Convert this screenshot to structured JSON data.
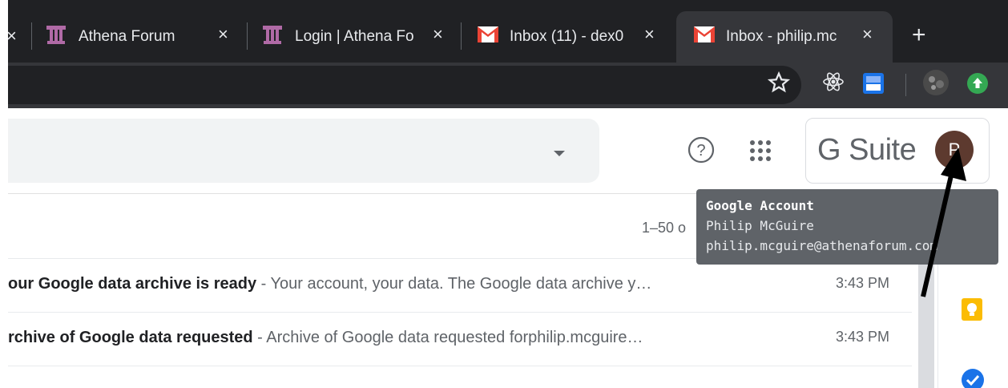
{
  "tabs": [
    {
      "label": "Athena Forum",
      "icon": "athena-column-icon"
    },
    {
      "label": "Login | Athena Fo",
      "icon": "athena-column-icon"
    },
    {
      "label": "Inbox (11) - dex0",
      "icon": "gmail-icon"
    },
    {
      "label": "Inbox - philip.mc",
      "icon": "gmail-icon",
      "active": true
    }
  ],
  "new_tab_label": "+",
  "close_glyph": "×",
  "toolbar": {
    "icons": [
      "star-icon",
      "react-extension-icon",
      "blue-extension-icon",
      "profile-avatar-icon",
      "green-upload-extension-icon"
    ]
  },
  "gmail": {
    "help_icon": "?",
    "gsuite_label": "G Suite",
    "avatar_letter": "P",
    "pagination": "1–50 o"
  },
  "tooltip": {
    "title": "Google Account",
    "name": "Philip McGuire",
    "email": "philip.mcguire@athenaforum.com"
  },
  "emails": [
    {
      "subject": "our Google data archive is ready",
      "snippet": " - Your account, your data. The Google data archive y…",
      "time": "3:43 PM"
    },
    {
      "subject": "rchive of Google data requested",
      "snippet": " - Archive of Google data requested forphilip.mcguire…",
      "time": "3:43 PM"
    }
  ],
  "colors": {
    "tabstrip": "#202124",
    "toolbar": "#35363a",
    "gmail_red": "#ea4335",
    "avatar": "#5d3a2f",
    "tooltip": "#5f6368"
  }
}
